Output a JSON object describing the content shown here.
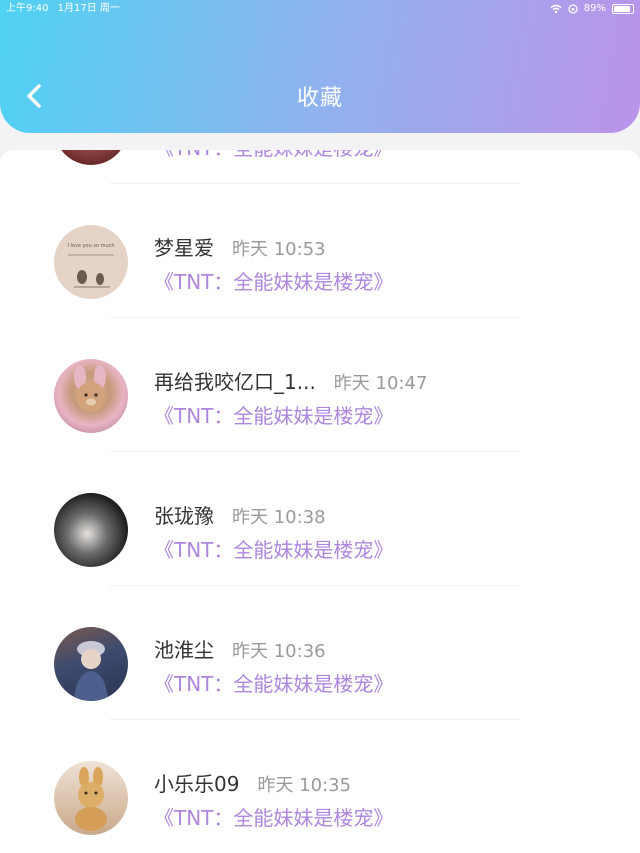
{
  "status_bar": {
    "time": "上午9:40",
    "date": "1月17日 周一",
    "battery": "89%",
    "battery_level": 0.89
  },
  "header": {
    "title": "收藏",
    "back_icon": "chevron-left-icon"
  },
  "colors": {
    "accent": "#ad86de",
    "gradient_start": "#4fd2f4",
    "gradient_end": "#bb93ea"
  },
  "items": [
    {
      "name": "",
      "time": "",
      "favorite": "《TNT：全能妹妹是楼宠》"
    },
    {
      "name": "梦星爱",
      "time": "昨天 10:53",
      "favorite": "《TNT：全能妹妹是楼宠》",
      "avatar_text": "I love you so much"
    },
    {
      "name": "再给我咬亿口_1...",
      "time": "昨天 10:47",
      "favorite": "《TNT：全能妹妹是楼宠》"
    },
    {
      "name": "张珑豫",
      "time": "昨天 10:38",
      "favorite": "《TNT：全能妹妹是楼宠》"
    },
    {
      "name": "池淮尘",
      "time": "昨天 10:36",
      "favorite": "《TNT：全能妹妹是楼宠》"
    },
    {
      "name": "小乐乐09",
      "time": "昨天 10:35",
      "favorite": "《TNT：全能妹妹是楼宠》"
    }
  ]
}
